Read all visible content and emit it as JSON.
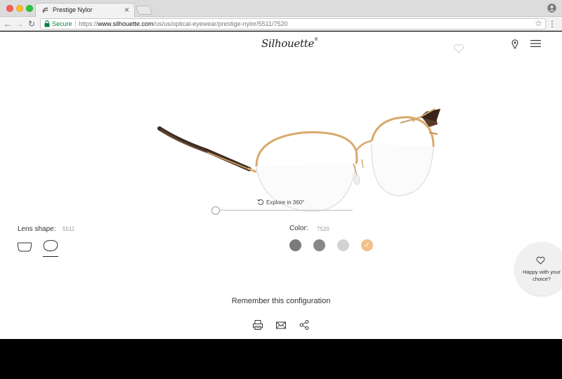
{
  "browser": {
    "tab_title": "Prestige Nylor",
    "tab_close": "×",
    "secure_label": "Secure",
    "url_scheme": "https://",
    "url_host": "www.silhouette.com",
    "url_path": "/us/us/optical-eyewear/prestige-nylor/5511/7520",
    "back": "←",
    "forward": "→",
    "reload": "↻",
    "star": "☆",
    "menu": "⋮"
  },
  "header": {
    "logo_text": "Silhouette",
    "logo_mark": "®"
  },
  "viewer": {
    "explore_label": "Explore in 360°",
    "rotation_position": 0
  },
  "lens_shape": {
    "label": "Lens shape:",
    "code": "5511",
    "options": [
      {
        "name": "rectangular",
        "selected": false
      },
      {
        "name": "round",
        "selected": true
      }
    ]
  },
  "color": {
    "label": "Color:",
    "code": "7520",
    "swatches": [
      {
        "color": "#7b7b7b",
        "selected": false
      },
      {
        "color": "#888888",
        "selected": false
      },
      {
        "color": "#d3d3d3",
        "selected": false
      },
      {
        "color": "#f2bf8a",
        "selected": true
      }
    ]
  },
  "happy": {
    "line1": "Happy with your",
    "line2": "choice?"
  },
  "remember": {
    "label": "Remember this configuration"
  },
  "icons": {
    "print": "printer-icon",
    "email": "envelope-icon",
    "share": "share-icon",
    "store": "location-pin-icon",
    "wishlist": "heart-icon"
  },
  "colors": {
    "accent_gold": "#d9a96b",
    "secure_green": "#0b8043"
  }
}
